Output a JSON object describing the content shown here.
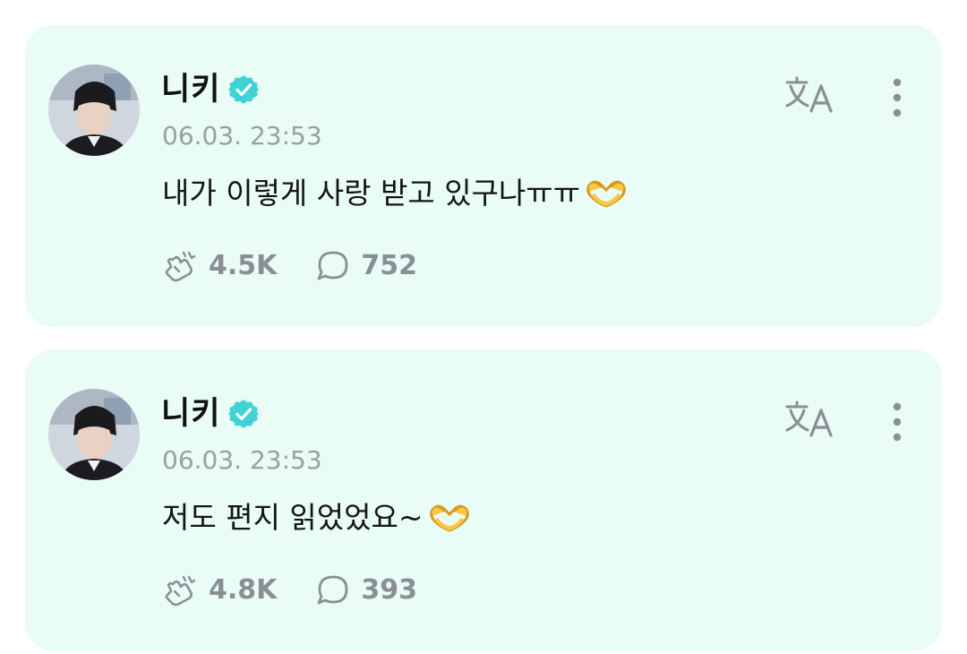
{
  "posts": [
    {
      "author": "니키",
      "verified": true,
      "timestamp": "06.03. 23:53",
      "text": "내가 이렇게 사랑 받고 있구나ㅠㅠ",
      "emoji": "heart-hands",
      "likes": "4.5K",
      "comments": "752"
    },
    {
      "author": "니키",
      "verified": true,
      "timestamp": "06.03. 23:53",
      "text": "저도 편지 읽었었요~",
      "emoji": "heart-hands",
      "likes": "4.8K",
      "comments": "393"
    }
  ],
  "icons": {
    "verified": "verified-badge-icon",
    "translate": "translate-icon",
    "more": "more-vertical-icon",
    "like": "cheer-hand-icon",
    "comment": "comment-bubble-icon"
  },
  "colors": {
    "card_background": "#e9fcf6",
    "verified_badge": "#3fd3d6",
    "muted_text": "#9a9fa3",
    "icon_gray": "#8a8f94"
  }
}
